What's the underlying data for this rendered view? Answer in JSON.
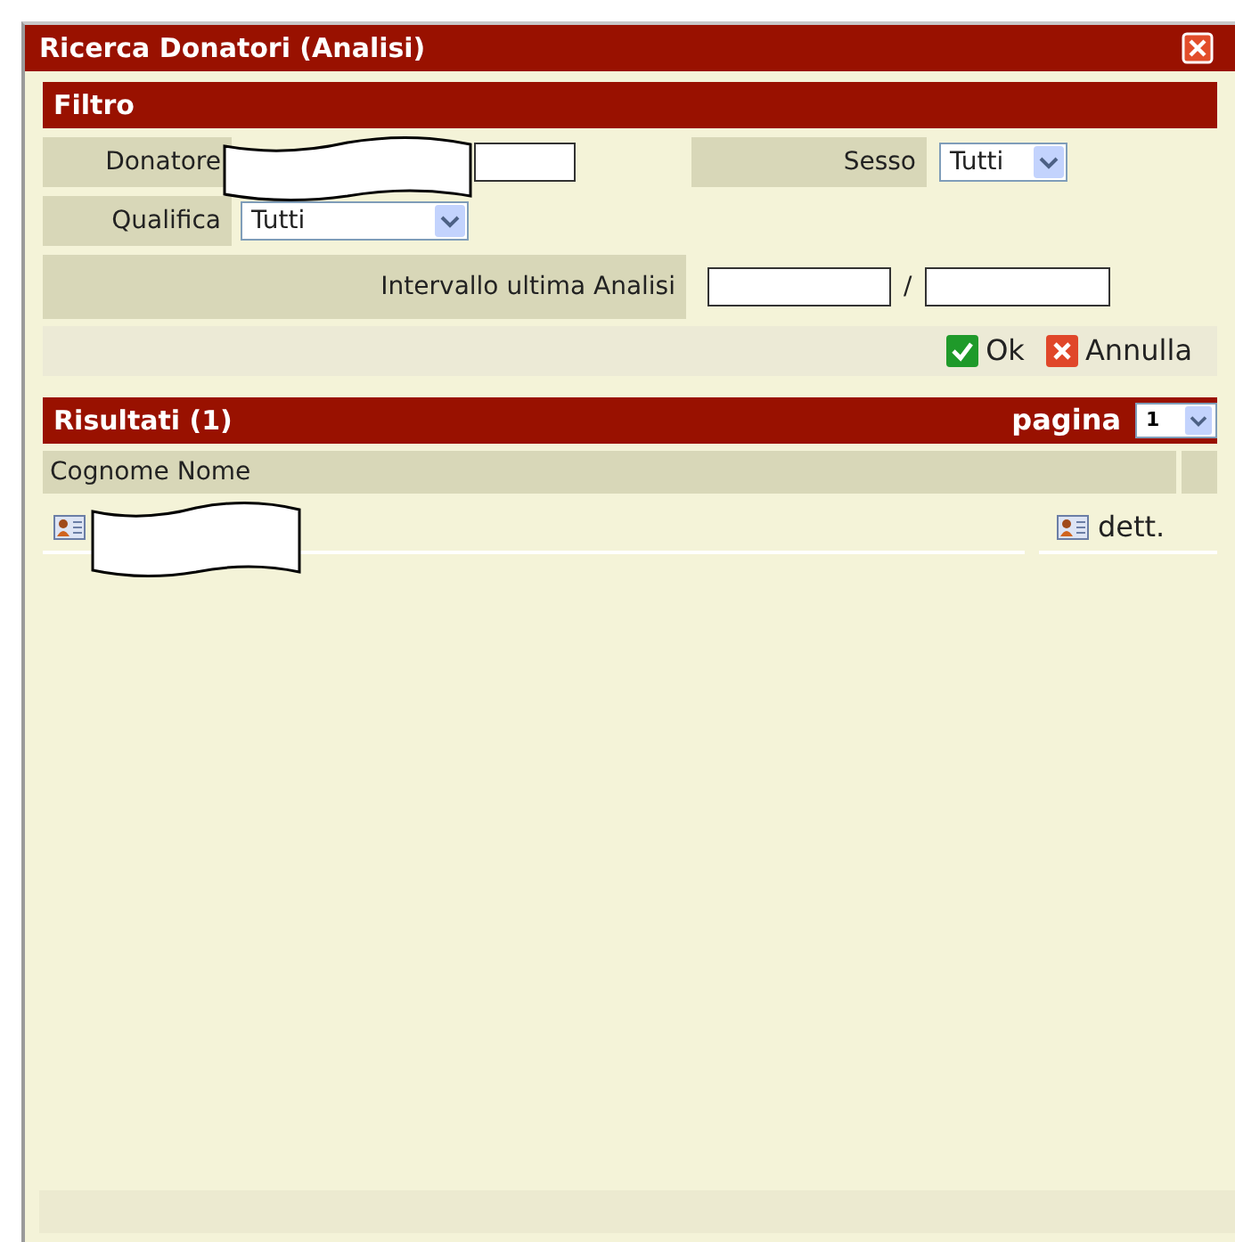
{
  "window": {
    "title": "Ricerca Donatori (Analisi)"
  },
  "filter": {
    "title": "Filtro",
    "fields": [
      {
        "kind": "text",
        "label": "Donatore",
        "redacted": true
      },
      {
        "kind": "select",
        "label": "Sesso",
        "value": "Tutti"
      },
      {
        "kind": "select",
        "label": "Qualifica",
        "value": "Tutti"
      },
      {
        "kind": "range",
        "label": "Intervallo ultima Analisi",
        "separator": "/"
      }
    ],
    "buttons": [
      {
        "kind": "ok",
        "label": "Ok"
      },
      {
        "kind": "cancel",
        "label": "Annulla"
      }
    ]
  },
  "results": {
    "title": "Risultati (1)",
    "page_label": "pagina",
    "page": "1",
    "columns": [
      "Cognome Nome"
    ],
    "rows": [
      {
        "redacted": true,
        "detail": "dett."
      }
    ]
  }
}
